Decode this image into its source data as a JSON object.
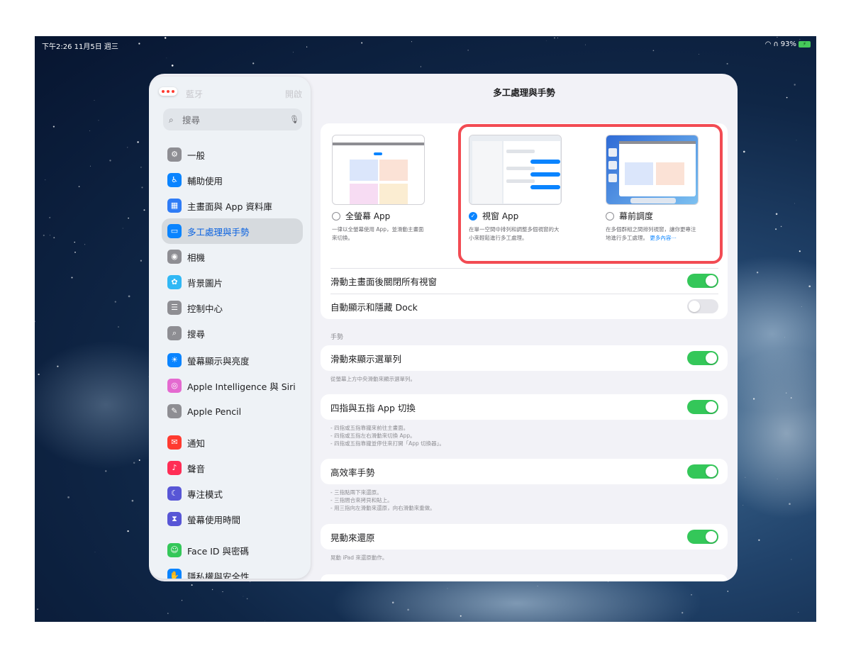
{
  "status_bar": {
    "time_date": "下午2:26  11月5日 週三",
    "battery": "93%"
  },
  "sidebar": {
    "faded_top_label": "藍牙",
    "faded_top_value": "開啟",
    "search_placeholder": "搜尋",
    "items": [
      {
        "label": "一般",
        "icon": "gear-icon",
        "color": "#8e8e93",
        "glyph": "⚙"
      },
      {
        "label": "輔助使用",
        "icon": "accessibility-icon",
        "color": "#0a84ff",
        "glyph": "♿"
      },
      {
        "label": "主畫面與 App 資料庫",
        "icon": "home-screen-icon",
        "color": "#2f7cf6",
        "glyph": "▦"
      },
      {
        "label": "多工處理與手勢",
        "icon": "multitasking-icon",
        "color": "#0a84ff",
        "glyph": "▭"
      },
      {
        "label": "相機",
        "icon": "camera-icon",
        "color": "#8e8e93",
        "glyph": "◉"
      },
      {
        "label": "背景圖片",
        "icon": "wallpaper-icon",
        "color": "#31b8f5",
        "glyph": "✿"
      },
      {
        "label": "控制中心",
        "icon": "control-center-icon",
        "color": "#8e8e93",
        "glyph": "☰"
      },
      {
        "label": "搜尋",
        "icon": "search-icon",
        "color": "#8e8e93",
        "glyph": "⌕"
      },
      {
        "label": "螢幕顯示與亮度",
        "icon": "brightness-icon",
        "color": "#0a84ff",
        "glyph": "☀"
      },
      {
        "label": "Apple Intelligence 與 Siri",
        "icon": "apple-intelligence-icon",
        "color": "#e46ad0",
        "glyph": "◎"
      },
      {
        "label": "Apple Pencil",
        "icon": "pencil-icon",
        "color": "#8e8e93",
        "glyph": "✎"
      },
      {
        "label": "通知",
        "icon": "notifications-icon",
        "color": "#ff3b30",
        "glyph": "✉"
      },
      {
        "label": "聲音",
        "icon": "sound-icon",
        "color": "#ff2d55",
        "glyph": "♪"
      },
      {
        "label": "專注模式",
        "icon": "focus-moon-icon",
        "color": "#5856d6",
        "glyph": "☾"
      },
      {
        "label": "螢幕使用時間",
        "icon": "screen-time-icon",
        "color": "#5856d6",
        "glyph": "⧗"
      },
      {
        "label": "Face ID 與密碼",
        "icon": "face-id-icon",
        "color": "#34c759",
        "glyph": "☺"
      },
      {
        "label": "隱私權與安全性",
        "icon": "privacy-hand-icon",
        "color": "#0a84ff",
        "glyph": "✋"
      }
    ]
  },
  "main": {
    "title": "多工處理與手勢",
    "modes": [
      {
        "label": "全螢幕 App",
        "checked": false,
        "desc": "一律以全螢幕使用 App，並滑動主畫面來切換。"
      },
      {
        "label": "視窗 App",
        "checked": true,
        "desc": "在單一空間中排列和調整多個視窗的大小來輕鬆進行多工處理。"
      },
      {
        "label": "幕前調度",
        "checked": false,
        "desc": "在多個群組之間排列視窗，讓你更專注地進行多工處理。",
        "link": "更多內容⋯"
      }
    ],
    "rows_top": [
      {
        "label": "滑動主畫面後關閉所有視窗",
        "on": true
      },
      {
        "label": "自動顯示和隱藏 Dock",
        "on": false
      }
    ],
    "gestures_header": "手勢",
    "gesture_rows": [
      {
        "label": "滑動來顯示選單列",
        "on": true,
        "footnote": [
          "從螢幕上方中央滑動來顯示選單列。"
        ]
      },
      {
        "label": "四指與五指 App 切換",
        "on": true,
        "footnote": [
          "- 四指或五指靠攏來前往主畫面。",
          "- 四指或五指左右滑動來切換 App。",
          "- 四指或五指靠攏並停住來打開「App 切換器」。"
        ]
      },
      {
        "label": "高效率手勢",
        "on": true,
        "footnote": [
          "- 三指點兩下來還原。",
          "- 三指閤合來拷貝和貼上。",
          "- 用三指向左滑動來還原，向右滑動來重做。"
        ]
      },
      {
        "label": "晃動來還原",
        "on": true,
        "footnote": [
          "晃動 iPad 來還原動作。"
        ]
      }
    ]
  }
}
